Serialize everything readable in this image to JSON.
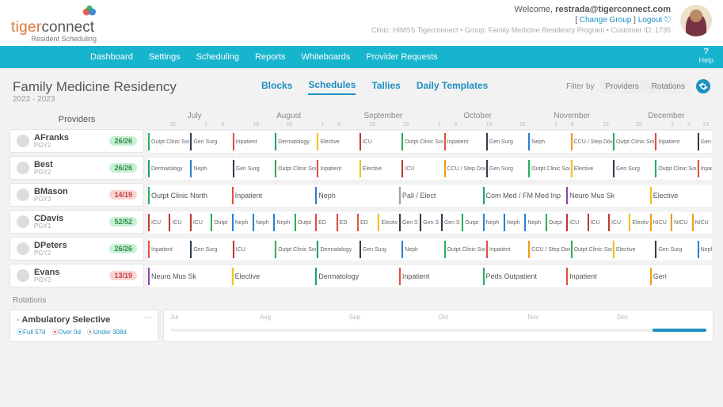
{
  "header": {
    "logo_tiger": "tiger",
    "logo_connect": "connect",
    "logo_sub": "Resident Scheduling",
    "welcome_prefix": "Welcome, ",
    "user_email": "restrada@tigerconnect.com",
    "change_group": "Change Group",
    "logout": "Logout",
    "meta": "Clinic: HIMSS Tigerconnect • Group: Family Medicine Residency Program • Customer ID: 1735"
  },
  "nav": {
    "items": [
      "Dashboard",
      "Settings",
      "Scheduling",
      "Reports",
      "Whiteboards",
      "Provider Requests"
    ],
    "help": "Help"
  },
  "page": {
    "title": "Family Medicine Residency",
    "year": "2022 - 2023",
    "subnav": [
      "Blocks",
      "Schedules",
      "Tallies",
      "Daily Templates"
    ],
    "subnav_active": 1,
    "filter_label": "Filter by",
    "filter_chips": [
      "Providers",
      "Rotations"
    ]
  },
  "providers_title": "Providers",
  "months": [
    "July",
    "August",
    "September",
    "October",
    "November",
    "December"
  ],
  "day_ticks": [
    "",
    "25",
    "",
    "1",
    "5",
    "",
    "15",
    "",
    "25",
    "",
    "1",
    "5",
    "",
    "15",
    "",
    "25",
    "",
    "1",
    "5",
    "",
    "15",
    "",
    "25",
    "",
    "1",
    "5",
    "",
    "15",
    "",
    "25",
    "",
    "1",
    "5",
    "13"
  ],
  "providers": [
    {
      "name": "AFranks",
      "level": "PGY2",
      "badge": "26/26",
      "badgeColor": "green"
    },
    {
      "name": "Best",
      "level": "PGY2",
      "badge": "26/26",
      "badgeColor": "green"
    },
    {
      "name": "BMason",
      "level": "PGY3",
      "badge": "14/19",
      "badgeColor": "red"
    },
    {
      "name": "CDavis",
      "level": "PGY1",
      "badge": "52/52",
      "badgeColor": "green"
    },
    {
      "name": "DPeters",
      "level": "PGY2",
      "badge": "26/26",
      "badgeColor": "green"
    },
    {
      "name": "Evans",
      "level": "PGY3",
      "badge": "13/19",
      "badgeColor": "red"
    }
  ],
  "colors": {
    "red": "#e74c3c",
    "orange": "#f39c12",
    "yellow": "#f1c40f",
    "green": "#27ae60",
    "teal": "#16a085",
    "blue": "#2980d9",
    "purple": "#8e44ad",
    "grey": "#95a5a6",
    "darkred": "#c0392b",
    "navy": "#2c3e50"
  },
  "rows": [
    [
      {
        "t": "Outpt Clinic South",
        "w": "w2",
        "c": "green"
      },
      {
        "t": "Gen Surg",
        "w": "w2",
        "c": "navy"
      },
      {
        "t": "Inpatient",
        "w": "w2",
        "c": "red"
      },
      {
        "t": "Dermatology",
        "w": "w2",
        "c": "teal"
      },
      {
        "t": "Elective",
        "w": "w2",
        "c": "yellow"
      },
      {
        "t": "ICU",
        "w": "w2",
        "c": "darkred"
      },
      {
        "t": "Outpt Clinic South",
        "w": "w2",
        "c": "green"
      },
      {
        "t": "Inpatient",
        "w": "w2",
        "c": "red"
      },
      {
        "t": "Gen Surg",
        "w": "w2",
        "c": "navy"
      },
      {
        "t": "Neph",
        "w": "w2",
        "c": "blue"
      },
      {
        "t": "CCU / Step Down",
        "w": "w2",
        "c": "orange"
      },
      {
        "t": "Outpt Clinic South",
        "w": "w2",
        "c": "green"
      },
      {
        "t": "Inpatient",
        "w": "w2",
        "c": "red"
      },
      {
        "t": "Gen Sur",
        "w": "w1",
        "c": "navy"
      }
    ],
    [
      {
        "t": "Dermatology",
        "w": "w2",
        "c": "teal"
      },
      {
        "t": "Neph",
        "w": "w2",
        "c": "blue"
      },
      {
        "t": "Gen Surg",
        "w": "w2",
        "c": "navy"
      },
      {
        "t": "Outpt Clinic South",
        "w": "w2",
        "c": "green"
      },
      {
        "t": "Inpatient",
        "w": "w2",
        "c": "red"
      },
      {
        "t": "Elective",
        "w": "w2",
        "c": "yellow"
      },
      {
        "t": "ICU",
        "w": "w2",
        "c": "darkred"
      },
      {
        "t": "CCU / Step Down",
        "w": "w2",
        "c": "orange"
      },
      {
        "t": "Gen Surg",
        "w": "w2",
        "c": "navy"
      },
      {
        "t": "Outpt Clinic South",
        "w": "w2",
        "c": "green"
      },
      {
        "t": "Elective",
        "w": "w2",
        "c": "yellow"
      },
      {
        "t": "Gen Surg",
        "w": "w2",
        "c": "navy"
      },
      {
        "t": "Outpt Clinic South",
        "w": "w2",
        "c": "green"
      },
      {
        "t": "Inpatient",
        "w": "w1",
        "c": "red"
      }
    ],
    [
      {
        "t": "Outpt Clinic North",
        "w": "w4",
        "c": "green",
        "big": 1
      },
      {
        "t": "Inpatient",
        "w": "w4",
        "c": "red",
        "big": 1
      },
      {
        "t": "Neph",
        "w": "w4",
        "c": "blue",
        "big": 1
      },
      {
        "t": "Pall / Elect",
        "w": "w4",
        "c": "grey",
        "big": 1
      },
      {
        "t": "Com Med / FM Med Inp",
        "w": "w4",
        "c": "teal",
        "big": 1
      },
      {
        "t": "Neuro Mus Sk",
        "w": "w4",
        "c": "purple",
        "big": 1
      },
      {
        "t": "Elective",
        "w": "w3",
        "c": "yellow",
        "big": 1
      }
    ],
    [
      {
        "t": "ICU",
        "w": "w1",
        "c": "darkred"
      },
      {
        "t": "ICU",
        "w": "w1",
        "c": "darkred"
      },
      {
        "t": "ICU",
        "w": "w1",
        "c": "darkred"
      },
      {
        "t": "Outpt",
        "w": "w1",
        "c": "green"
      },
      {
        "t": "Neph",
        "w": "w1",
        "c": "blue"
      },
      {
        "t": "Neph",
        "w": "w1",
        "c": "blue"
      },
      {
        "t": "Neph",
        "w": "w1",
        "c": "blue"
      },
      {
        "t": "Outpt",
        "w": "w1",
        "c": "green"
      },
      {
        "t": "ED",
        "w": "w1",
        "c": "red"
      },
      {
        "t": "ED",
        "w": "w1",
        "c": "red"
      },
      {
        "t": "ED",
        "w": "w1",
        "c": "red"
      },
      {
        "t": "Electiv",
        "w": "w1",
        "c": "yellow"
      },
      {
        "t": "Gen S",
        "w": "w1",
        "c": "navy"
      },
      {
        "t": "Gen S",
        "w": "w1",
        "c": "navy"
      },
      {
        "t": "Gen S",
        "w": "w1",
        "c": "navy"
      },
      {
        "t": "Outpt",
        "w": "w1",
        "c": "green"
      },
      {
        "t": "Neph",
        "w": "w1",
        "c": "blue"
      },
      {
        "t": "Neph",
        "w": "w1",
        "c": "blue"
      },
      {
        "t": "Neph",
        "w": "w1",
        "c": "blue"
      },
      {
        "t": "Outpt",
        "w": "w1",
        "c": "green"
      },
      {
        "t": "ICU",
        "w": "w1",
        "c": "darkred"
      },
      {
        "t": "ICU",
        "w": "w1",
        "c": "darkred"
      },
      {
        "t": "ICU",
        "w": "w1",
        "c": "darkred"
      },
      {
        "t": "Electiv",
        "w": "w1",
        "c": "yellow"
      },
      {
        "t": "NICU",
        "w": "w1",
        "c": "orange"
      },
      {
        "t": "NICU",
        "w": "w1",
        "c": "orange"
      },
      {
        "t": "NICU",
        "w": "w1",
        "c": "orange"
      }
    ],
    [
      {
        "t": "Inpatient",
        "w": "w2",
        "c": "red"
      },
      {
        "t": "Gen Surg",
        "w": "w2",
        "c": "navy"
      },
      {
        "t": "ICU",
        "w": "w2",
        "c": "darkred"
      },
      {
        "t": "Outpt Clinic South",
        "w": "w2",
        "c": "green"
      },
      {
        "t": "Dermatology",
        "w": "w2",
        "c": "teal"
      },
      {
        "t": "Gen Surg",
        "w": "w2",
        "c": "navy"
      },
      {
        "t": "Neph",
        "w": "w2",
        "c": "blue"
      },
      {
        "t": "Outpt Clinic South",
        "w": "w2",
        "c": "green"
      },
      {
        "t": "Inpatient",
        "w": "w2",
        "c": "red"
      },
      {
        "t": "CCU / Step Down",
        "w": "w2",
        "c": "orange"
      },
      {
        "t": "Outpt Clinic South",
        "w": "w2",
        "c": "green"
      },
      {
        "t": "Elective",
        "w": "w2",
        "c": "yellow"
      },
      {
        "t": "Gen Surg",
        "w": "w2",
        "c": "navy"
      },
      {
        "t": "Neph",
        "w": "w1",
        "c": "blue"
      }
    ],
    [
      {
        "t": "Neuro Mus Sk",
        "w": "w4",
        "c": "purple",
        "big": 1
      },
      {
        "t": "Elective",
        "w": "w4",
        "c": "yellow",
        "big": 1
      },
      {
        "t": "Dermatology",
        "w": "w4",
        "c": "teal",
        "big": 1
      },
      {
        "t": "Inpatient",
        "w": "w4",
        "c": "red",
        "big": 1
      },
      {
        "t": "Peds Outpatient",
        "w": "w4",
        "c": "green",
        "big": 1
      },
      {
        "t": "Inpatient",
        "w": "w4",
        "c": "red",
        "big": 1
      },
      {
        "t": "Geri",
        "w": "w3",
        "c": "orange",
        "big": 1
      }
    ]
  ],
  "rotations": {
    "label": "Rotations",
    "card": {
      "title": "Ambulatory Selective",
      "full": "Full 57d",
      "over": "Over 0d",
      "under": "Under 308d"
    },
    "timeline_months": [
      "Jul",
      "Aug",
      "Sep",
      "Oct",
      "Nov",
      "Dec"
    ]
  }
}
